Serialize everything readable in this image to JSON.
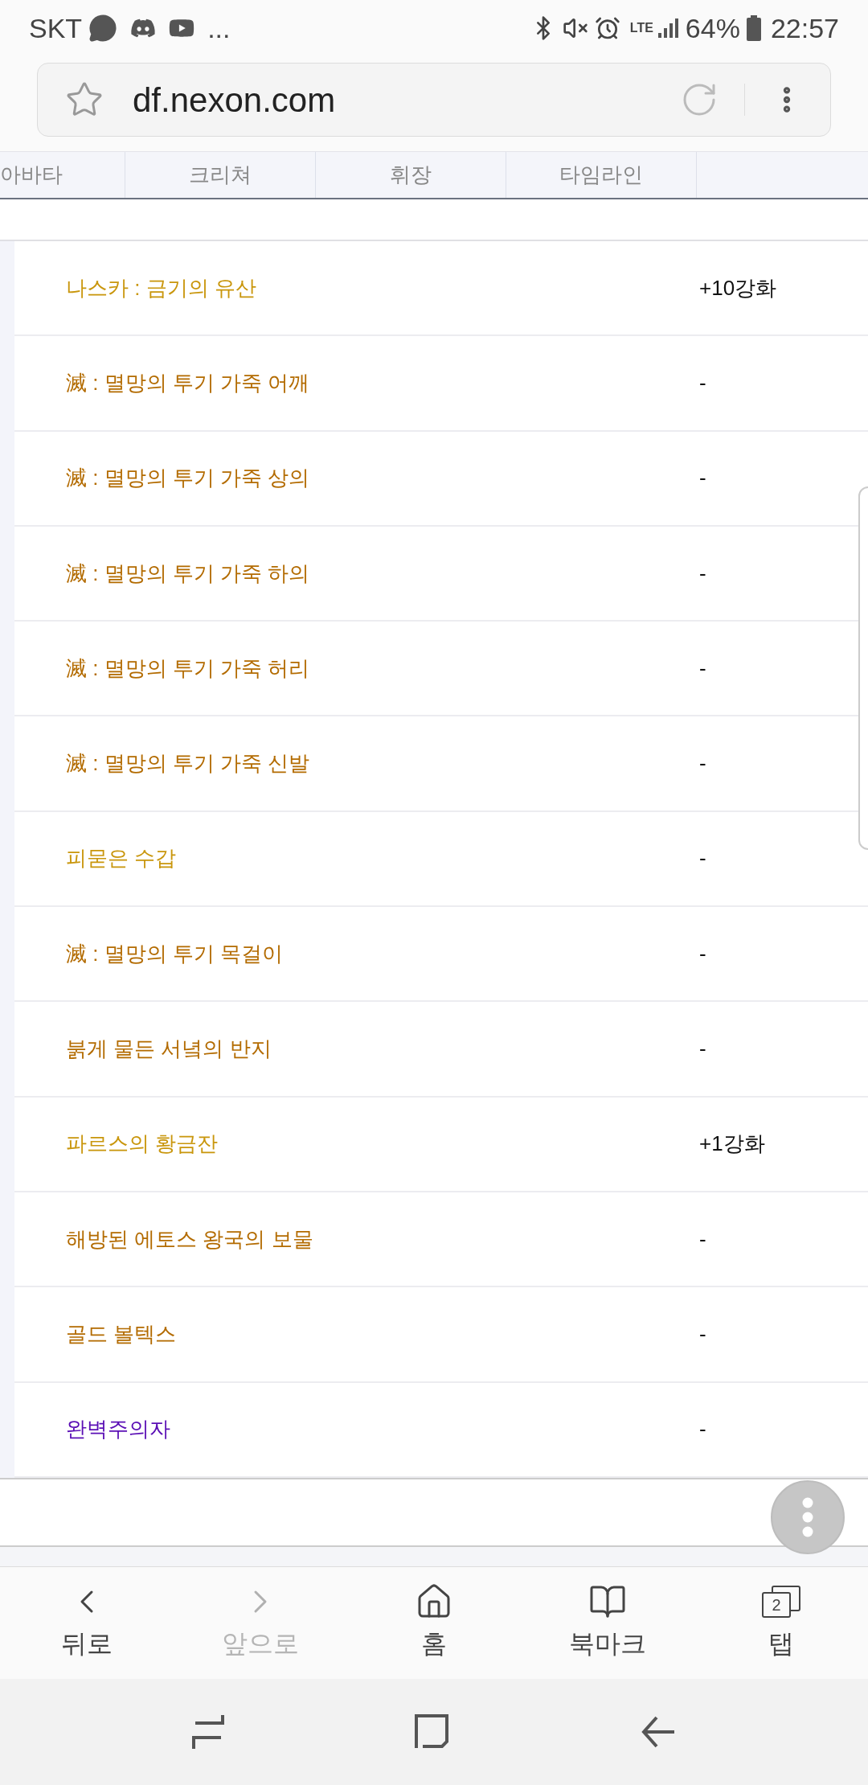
{
  "status_bar": {
    "carrier": "SKT",
    "more": "...",
    "network": "LTE",
    "battery": "64%",
    "time": "22:57"
  },
  "address_bar": {
    "url": "df.nexon.com"
  },
  "tabs": [
    {
      "label": "아바타"
    },
    {
      "label": "크리쳐"
    },
    {
      "label": "휘장"
    },
    {
      "label": "타임라인"
    }
  ],
  "items": [
    {
      "name": "나스카 : 금기의 유산",
      "color": "#c9960c",
      "value": "+10강화"
    },
    {
      "name": "滅 : 멸망의 투기 가죽 어깨",
      "color": "#b36b00",
      "value": "-"
    },
    {
      "name": "滅 : 멸망의 투기 가죽 상의",
      "color": "#b36b00",
      "value": "-"
    },
    {
      "name": "滅 : 멸망의 투기 가죽 하의",
      "color": "#b36b00",
      "value": "-"
    },
    {
      "name": "滅 : 멸망의 투기 가죽 허리",
      "color": "#b36b00",
      "value": "-"
    },
    {
      "name": "滅 : 멸망의 투기 가죽 신발",
      "color": "#b36b00",
      "value": "-"
    },
    {
      "name": "피묻은 수갑",
      "color": "#c9960c",
      "value": "-"
    },
    {
      "name": "滅 : 멸망의 투기 목걸이",
      "color": "#b36b00",
      "value": "-"
    },
    {
      "name": "붉게 물든 서녘의 반지",
      "color": "#b36b00",
      "value": "-"
    },
    {
      "name": "파르스의 황금잔",
      "color": "#c9960c",
      "value": "+1강화"
    },
    {
      "name": "해방된 에토스 왕국의 보물",
      "color": "#b36b00",
      "value": "-"
    },
    {
      "name": "골드 볼텍스",
      "color": "#b36b00",
      "value": "-"
    },
    {
      "name": "완벽주의자",
      "color": "#5a0eb5",
      "value": "-"
    }
  ],
  "bottom_nav": [
    {
      "kind": "back",
      "label": "뒤로",
      "disabled": false
    },
    {
      "kind": "forward",
      "label": "앞으로",
      "disabled": true
    },
    {
      "kind": "home",
      "label": "홈",
      "disabled": false
    },
    {
      "kind": "bookmark",
      "label": "북마크",
      "disabled": false
    },
    {
      "kind": "tabs",
      "label": "탭",
      "disabled": false,
      "count": "2"
    }
  ]
}
